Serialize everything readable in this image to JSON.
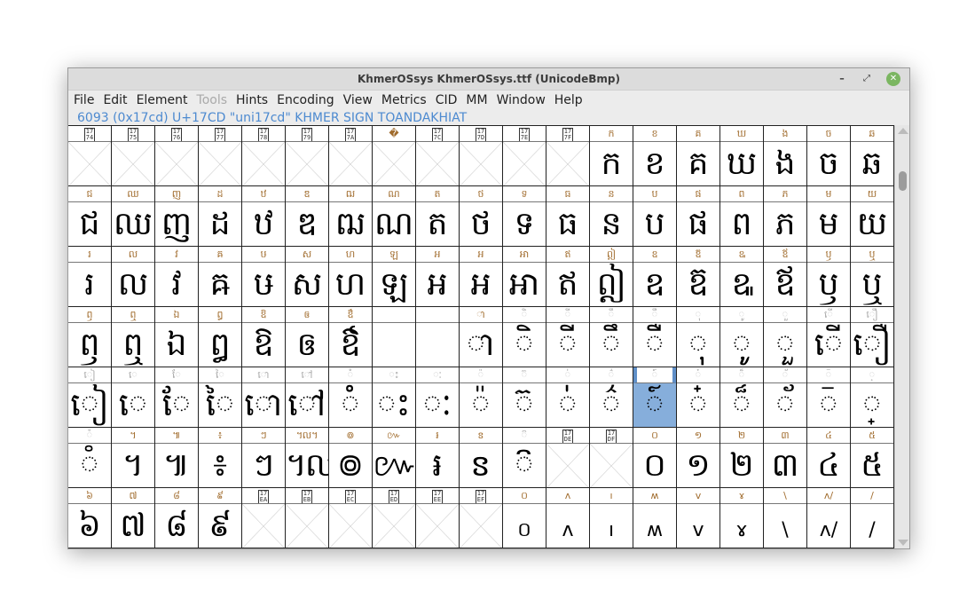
{
  "window": {
    "title": "KhmerOSsys  KhmerOSsys.ttf (UnicodeBmp)",
    "controls": {
      "minimize": "–",
      "maximize": "⤢",
      "close": "✕"
    }
  },
  "menu": [
    {
      "label": "File",
      "disabled": false
    },
    {
      "label": "Edit",
      "disabled": false
    },
    {
      "label": "Element",
      "disabled": false
    },
    {
      "label": "Tools",
      "disabled": true
    },
    {
      "label": "Hints",
      "disabled": false
    },
    {
      "label": "Encoding",
      "disabled": false
    },
    {
      "label": "View",
      "disabled": false
    },
    {
      "label": "Metrics",
      "disabled": false
    },
    {
      "label": "CID",
      "disabled": false
    },
    {
      "label": "MM",
      "disabled": false
    },
    {
      "label": "Window",
      "disabled": false
    },
    {
      "label": "Help",
      "disabled": false
    }
  ],
  "info": "6093 (0x17cd) U+17CD \"uni17cd\" KHMER SIGN TOANDAKHIAT",
  "selected_codepoint": "17CD",
  "colors": {
    "accent": "#4d8ad0",
    "selection": "#86aedb",
    "label": "#a06b2c"
  },
  "rows": [
    [
      {
        "cp": "1774",
        "missing": true
      },
      {
        "cp": "1775",
        "missing": true
      },
      {
        "cp": "1776",
        "missing": true
      },
      {
        "cp": "1777",
        "missing": true
      },
      {
        "cp": "1778",
        "missing": true
      },
      {
        "cp": "1779",
        "missing": true
      },
      {
        "cp": "177A",
        "missing": true
      },
      {
        "cp": "177B",
        "missing": true,
        "label": "�"
      },
      {
        "cp": "177C",
        "missing": true
      },
      {
        "cp": "177D",
        "missing": true
      },
      {
        "cp": "177E",
        "missing": true
      },
      {
        "cp": "177F",
        "missing": true
      },
      {
        "cp": "1780",
        "glyph": "ក"
      },
      {
        "cp": "1781",
        "glyph": "ខ"
      },
      {
        "cp": "1782",
        "glyph": "គ"
      },
      {
        "cp": "1783",
        "glyph": "ឃ"
      },
      {
        "cp": "1784",
        "glyph": "ង"
      },
      {
        "cp": "1785",
        "glyph": "ច"
      },
      {
        "cp": "1786",
        "glyph": "ឆ"
      }
    ],
    [
      {
        "cp": "1787",
        "glyph": "ជ"
      },
      {
        "cp": "1788",
        "glyph": "ឈ"
      },
      {
        "cp": "1789",
        "glyph": "ញ"
      },
      {
        "cp": "178A",
        "glyph": "ដ"
      },
      {
        "cp": "178B",
        "glyph": "ឋ"
      },
      {
        "cp": "178C",
        "glyph": "ឌ"
      },
      {
        "cp": "178D",
        "glyph": "ឍ"
      },
      {
        "cp": "178E",
        "glyph": "ណ"
      },
      {
        "cp": "178F",
        "glyph": "ត"
      },
      {
        "cp": "1790",
        "glyph": "ថ"
      },
      {
        "cp": "1791",
        "glyph": "ទ"
      },
      {
        "cp": "1792",
        "glyph": "ធ"
      },
      {
        "cp": "1793",
        "glyph": "ន"
      },
      {
        "cp": "1794",
        "glyph": "ប"
      },
      {
        "cp": "1795",
        "glyph": "ផ"
      },
      {
        "cp": "1796",
        "glyph": "ព"
      },
      {
        "cp": "1797",
        "glyph": "ភ"
      },
      {
        "cp": "1798",
        "glyph": "ម"
      },
      {
        "cp": "1799",
        "glyph": "យ"
      }
    ],
    [
      {
        "cp": "179A",
        "glyph": "រ"
      },
      {
        "cp": "179B",
        "glyph": "ល"
      },
      {
        "cp": "179C",
        "glyph": "វ"
      },
      {
        "cp": "179D",
        "glyph": "ឝ"
      },
      {
        "cp": "179E",
        "glyph": "ឞ"
      },
      {
        "cp": "179F",
        "glyph": "ស"
      },
      {
        "cp": "17A0",
        "glyph": "ហ"
      },
      {
        "cp": "17A1",
        "glyph": "ឡ"
      },
      {
        "cp": "17A2",
        "glyph": "អ"
      },
      {
        "cp": "17A3",
        "glyph": "ឣ"
      },
      {
        "cp": "17A4",
        "glyph": "ឤ"
      },
      {
        "cp": "17A5",
        "glyph": "ឥ"
      },
      {
        "cp": "17A6",
        "glyph": "ឦ"
      },
      {
        "cp": "17A7",
        "glyph": "ឧ"
      },
      {
        "cp": "17A8",
        "glyph": "ឨ"
      },
      {
        "cp": "17A9",
        "glyph": "ឩ"
      },
      {
        "cp": "17AA",
        "glyph": "ឪ"
      },
      {
        "cp": "17AB",
        "glyph": "ឫ"
      },
      {
        "cp": "17AC",
        "glyph": "ឬ"
      }
    ],
    [
      {
        "cp": "17AD",
        "glyph": "ឭ"
      },
      {
        "cp": "17AE",
        "glyph": "ឮ"
      },
      {
        "cp": "17AF",
        "glyph": "ឯ"
      },
      {
        "cp": "17B0",
        "glyph": "ឰ"
      },
      {
        "cp": "17B1",
        "glyph": "ឱ"
      },
      {
        "cp": "17B2",
        "glyph": "ឲ"
      },
      {
        "cp": "17B3",
        "glyph": "ឳ"
      },
      {
        "cp": "17B4",
        "glyph": "឴",
        "mark": true
      },
      {
        "cp": "17B5",
        "glyph": "឵",
        "mark": true
      },
      {
        "cp": "17B6",
        "glyph": "ា"
      },
      {
        "cp": "17B7",
        "glyph": "◌ិ",
        "mark": true
      },
      {
        "cp": "17B8",
        "glyph": "◌ី",
        "mark": true
      },
      {
        "cp": "17B9",
        "glyph": "◌ឹ",
        "mark": true
      },
      {
        "cp": "17BA",
        "glyph": "◌ឺ",
        "mark": true
      },
      {
        "cp": "17BB",
        "glyph": "◌ុ",
        "mark": true
      },
      {
        "cp": "17BC",
        "glyph": "◌ូ",
        "mark": true
      },
      {
        "cp": "17BD",
        "glyph": "◌ួ",
        "mark": true
      },
      {
        "cp": "17BE",
        "glyph": "◌ើ",
        "mark": true
      },
      {
        "cp": "17BF",
        "glyph": "◌ឿ",
        "mark": true
      }
    ],
    [
      {
        "cp": "17C0",
        "glyph": "◌ៀ",
        "mark": true
      },
      {
        "cp": "17C1",
        "glyph": "◌េ",
        "mark": true
      },
      {
        "cp": "17C2",
        "glyph": "◌ែ",
        "mark": true
      },
      {
        "cp": "17C3",
        "glyph": "◌ៃ",
        "mark": true
      },
      {
        "cp": "17C4",
        "glyph": "◌ោ",
        "mark": true
      },
      {
        "cp": "17C5",
        "glyph": "◌ៅ",
        "mark": true
      },
      {
        "cp": "17C6",
        "glyph": "◌ំ",
        "mark": true
      },
      {
        "cp": "17C7",
        "glyph": "ះ",
        "mark": true
      },
      {
        "cp": "17C8",
        "glyph": "ៈ",
        "mark": true
      },
      {
        "cp": "17C9",
        "glyph": "◌៉",
        "mark": true
      },
      {
        "cp": "17CA",
        "glyph": "◌៊",
        "mark": true
      },
      {
        "cp": "17CB",
        "glyph": "◌់",
        "mark": true
      },
      {
        "cp": "17CC",
        "glyph": "◌៌",
        "mark": true
      },
      {
        "cp": "17CD",
        "glyph": "◌៍",
        "mark": true,
        "selected": true
      },
      {
        "cp": "17CE",
        "glyph": "◌៎",
        "mark": true
      },
      {
        "cp": "17CF",
        "glyph": "◌៏",
        "mark": true
      },
      {
        "cp": "17D0",
        "glyph": "◌័",
        "mark": true
      },
      {
        "cp": "17D1",
        "glyph": "◌៑",
        "mark": true
      },
      {
        "cp": "17D2",
        "glyph": "◌្",
        "mark": true
      }
    ],
    [
      {
        "cp": "17D3",
        "glyph": "◌៓",
        "mark": true
      },
      {
        "cp": "17D4",
        "glyph": "។"
      },
      {
        "cp": "17D5",
        "glyph": "៕"
      },
      {
        "cp": "17D6",
        "glyph": "៖"
      },
      {
        "cp": "17D7",
        "glyph": "ៗ"
      },
      {
        "cp": "17D8",
        "glyph": "៘"
      },
      {
        "cp": "17D9",
        "glyph": "៙"
      },
      {
        "cp": "17DA",
        "glyph": "៚"
      },
      {
        "cp": "17DB",
        "glyph": "៛"
      },
      {
        "cp": "17DC",
        "glyph": "ៜ"
      },
      {
        "cp": "17DD",
        "glyph": "◌៝",
        "mark": true
      },
      {
        "cp": "17DE",
        "missing": true
      },
      {
        "cp": "17DF",
        "missing": true
      },
      {
        "cp": "17E0",
        "glyph": "០"
      },
      {
        "cp": "17E1",
        "glyph": "១"
      },
      {
        "cp": "17E2",
        "glyph": "២"
      },
      {
        "cp": "17E3",
        "glyph": "៣"
      },
      {
        "cp": "17E4",
        "glyph": "៤"
      },
      {
        "cp": "17E5",
        "glyph": "៥"
      }
    ],
    [
      {
        "cp": "17E6",
        "glyph": "៦"
      },
      {
        "cp": "17E7",
        "glyph": "៧"
      },
      {
        "cp": "17E8",
        "glyph": "៨"
      },
      {
        "cp": "17E9",
        "glyph": "៩"
      },
      {
        "cp": "17EA",
        "missing": true
      },
      {
        "cp": "17EB",
        "missing": true
      },
      {
        "cp": "17EC",
        "missing": true
      },
      {
        "cp": "17ED",
        "missing": true
      },
      {
        "cp": "17EE",
        "missing": true
      },
      {
        "cp": "17EF",
        "missing": true
      },
      {
        "cp": "17F0",
        "glyph": "០",
        "small": true
      },
      {
        "cp": "17F1",
        "glyph": "ʌ",
        "small": true
      },
      {
        "cp": "17F2",
        "glyph": "ı",
        "small": true
      },
      {
        "cp": "17F3",
        "glyph": "ʍ",
        "small": true
      },
      {
        "cp": "17F4",
        "glyph": "v",
        "small": true
      },
      {
        "cp": "17F5",
        "glyph": "ɤ",
        "small": true
      },
      {
        "cp": "17F6",
        "glyph": "\\",
        "small": true
      },
      {
        "cp": "17F7",
        "glyph": "ʌ/",
        "small": true
      },
      {
        "cp": "17F8",
        "glyph": "/",
        "small": true
      }
    ]
  ]
}
